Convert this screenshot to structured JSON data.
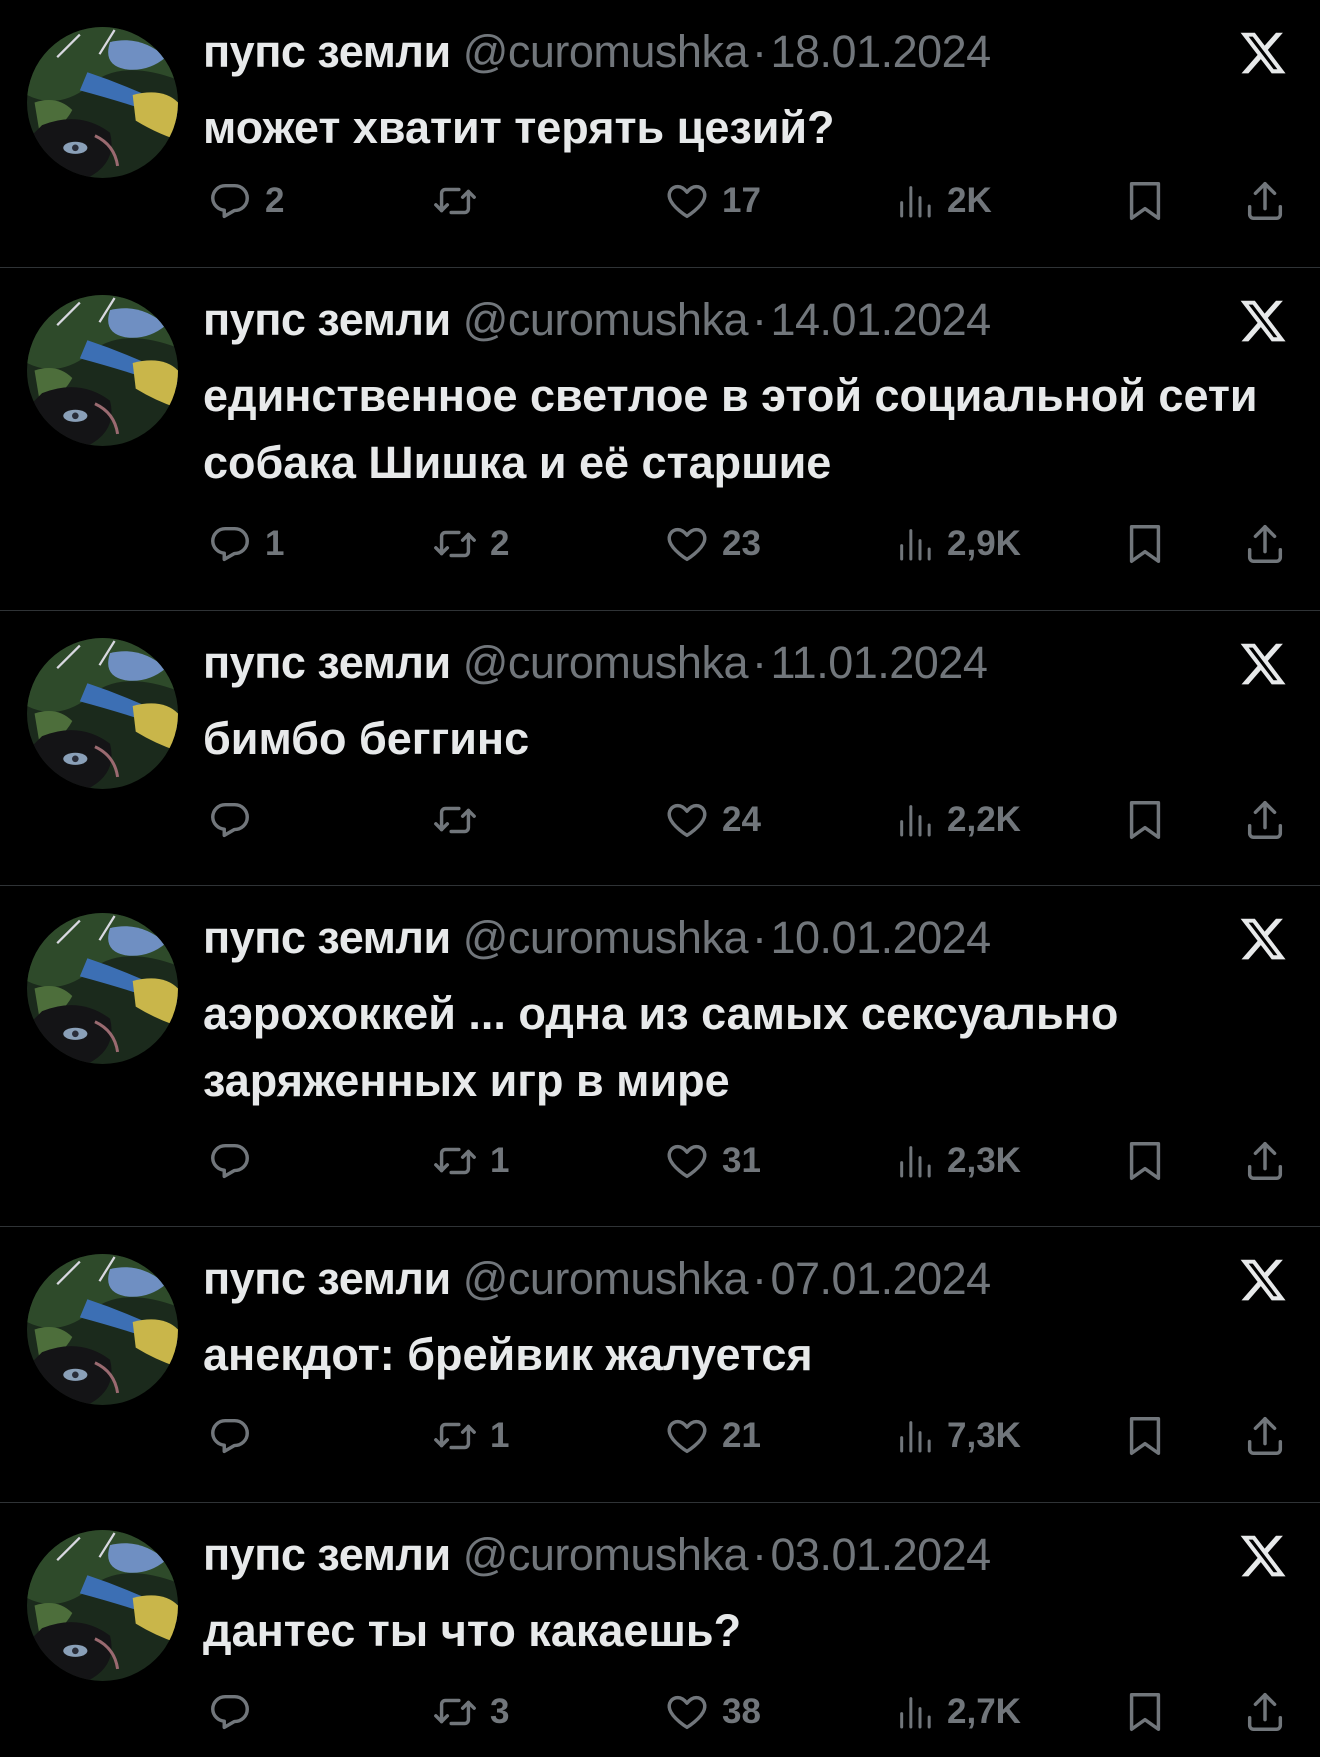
{
  "colors": {
    "background": "#000000",
    "primary_text": "#e7e9ea",
    "secondary_text": "#71767b",
    "divider": "#2f3336"
  },
  "icons": {
    "reply": "speech-bubble-icon",
    "retweet": "retweet-arrows-icon",
    "like": "heart-icon",
    "views": "bar-chart-icon",
    "bookmark": "bookmark-icon",
    "share": "share-upload-icon",
    "brand": "x-logo-icon"
  },
  "tweets": [
    {
      "name": "пупс земли",
      "handle": "@curomushka",
      "separator": "·",
      "date": "18.01.2024",
      "text": "может хватит терять цезий?",
      "replies": "2",
      "retweets": "",
      "likes": "17",
      "views": "2K"
    },
    {
      "name": "пупс земли",
      "handle": "@curomushka",
      "separator": "·",
      "date": "14.01.2024",
      "text": "единственное светлое в этой социальной сети собака Шишка и её старшие",
      "replies": "1",
      "retweets": "2",
      "likes": "23",
      "views": "2,9K"
    },
    {
      "name": "пупс земли",
      "handle": "@curomushka",
      "separator": "·",
      "date": "11.01.2024",
      "text": "бимбо беггинс",
      "replies": "",
      "retweets": "",
      "likes": "24",
      "views": "2,2K"
    },
    {
      "name": "пупс земли",
      "handle": "@curomushka",
      "separator": "·",
      "date": "10.01.2024",
      "text": "аэрохоккей ... одна из самых сексуально заряженных игр в мире",
      "replies": "",
      "retweets": "1",
      "likes": "31",
      "views": "2,3K"
    },
    {
      "name": "пупс земли",
      "handle": "@curomushka",
      "separator": "·",
      "date": "07.01.2024",
      "text": "анекдот: брейвик жалуется",
      "replies": "",
      "retweets": "1",
      "likes": "21",
      "views": "7,3K"
    },
    {
      "name": "пупс земли",
      "handle": "@curomushka",
      "separator": "·",
      "date": "03.01.2024",
      "text": "дантес ты что какаешь?",
      "replies": "",
      "retweets": "3",
      "likes": "38",
      "views": "2,7K"
    }
  ]
}
